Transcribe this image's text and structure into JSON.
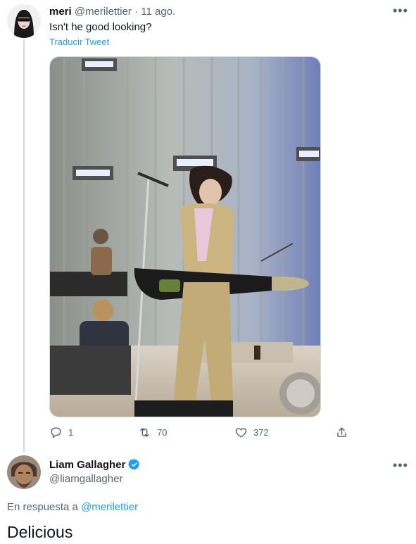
{
  "tweet": {
    "author_name": "meri",
    "author_handle": "@merilettier",
    "separator": " · ",
    "date": "11 ago.",
    "text": "Isn't he good looking?",
    "translate_label": "Traducir Tweet",
    "replies": "1",
    "retweets": "70",
    "likes": "372"
  },
  "reply": {
    "author_name": "Liam Gallagher",
    "author_handle": "@liamgallagher",
    "in_reply_prefix": "En respuesta a ",
    "in_reply_to": "@merilettier",
    "text": "Delicious"
  },
  "icons": {
    "more": "more-horizontal-icon",
    "reply": "reply-icon",
    "retweet": "retweet-icon",
    "like": "like-icon",
    "share": "share-icon",
    "verified": "verified-badge-icon"
  },
  "colors": {
    "link": "#1d9bf0",
    "muted": "#536471",
    "text": "#0f1419",
    "verified": "#1d9bf0"
  }
}
